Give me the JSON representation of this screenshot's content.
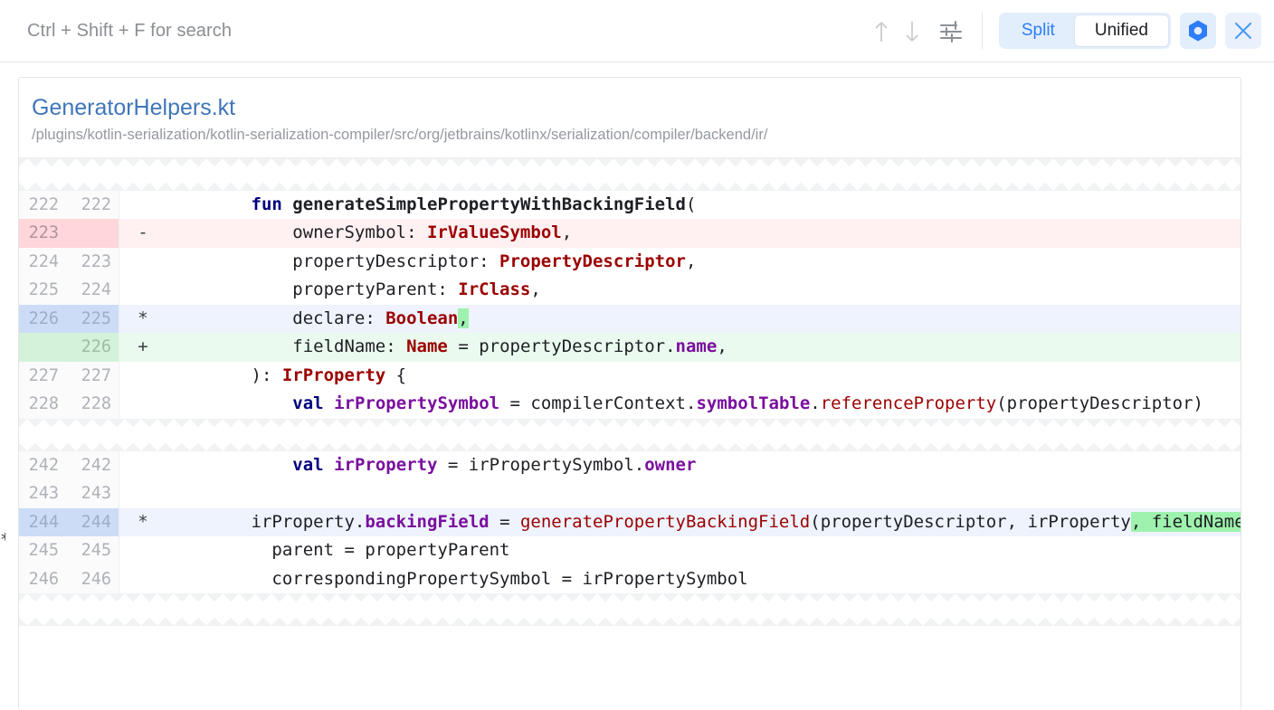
{
  "toolbar": {
    "search_placeholder": "Ctrl + Shift + F for search",
    "prev_diff_icon": "arrow-up-icon",
    "next_diff_icon": "arrow-down-icon",
    "settings_icon": "sliders-settings-icon",
    "view_modes": [
      {
        "label": "Split",
        "active": false
      },
      {
        "label": "Unified",
        "active": true
      }
    ],
    "hexagon_icon": "hexagon-nut-icon",
    "close_icon": "close-x-icon",
    "accent_color": "#2e7dfa",
    "toggle_bg_color": "#e3eefd"
  },
  "file": {
    "name": "GeneratorHelpers.kt",
    "path": "/plugins/kotlin-serialization/kotlin-serialization-compiler/src/org/jetbrains/kotlinx/serialization/compiler/backend/ir/",
    "name_color": "#3f76b8",
    "path_color": "#9599a0"
  },
  "diff": {
    "edge_marker": "*",
    "hunks": [
      {
        "rows": [
          {
            "old": "222",
            "new": "222",
            "marker": "",
            "state": "ctx",
            "segments": [
              {
                "t": "        ",
                "c": ""
              },
              {
                "t": "fun",
                "c": "kw"
              },
              {
                "t": " ",
                "c": ""
              },
              {
                "t": "generateSimplePropertyWithBackingField",
                "c": "fn"
              },
              {
                "t": "(",
                "c": ""
              }
            ]
          },
          {
            "old": "223",
            "new": "",
            "marker": "-",
            "state": "del",
            "segments": [
              {
                "t": "            ownerSymbol: ",
                "c": ""
              },
              {
                "t": "IrValueSymbol",
                "c": "typ"
              },
              {
                "t": ",",
                "c": ""
              }
            ]
          },
          {
            "old": "224",
            "new": "223",
            "marker": "",
            "state": "ctx",
            "segments": [
              {
                "t": "            propertyDescriptor: ",
                "c": ""
              },
              {
                "t": "PropertyDescriptor",
                "c": "typ"
              },
              {
                "t": ",",
                "c": ""
              }
            ]
          },
          {
            "old": "225",
            "new": "224",
            "marker": "",
            "state": "ctx",
            "segments": [
              {
                "t": "            propertyParent: ",
                "c": ""
              },
              {
                "t": "IrClass",
                "c": "typ"
              },
              {
                "t": ",",
                "c": ""
              }
            ]
          },
          {
            "old": "226",
            "new": "225",
            "marker": "*",
            "state": "mod",
            "segments": [
              {
                "t": "            declare: ",
                "c": ""
              },
              {
                "t": "Boolean",
                "c": "typ"
              },
              {
                "t": ",",
                "c": "hl"
              }
            ]
          },
          {
            "old": "",
            "new": "226",
            "marker": "+",
            "state": "add",
            "segments": [
              {
                "t": "            fieldName: ",
                "c": ""
              },
              {
                "t": "Name",
                "c": "typ"
              },
              {
                "t": " = propertyDescriptor.",
                "c": ""
              },
              {
                "t": "name",
                "c": "prop"
              },
              {
                "t": ",",
                "c": ""
              }
            ]
          },
          {
            "old": "227",
            "new": "227",
            "marker": "",
            "state": "ctx",
            "segments": [
              {
                "t": "        ): ",
                "c": ""
              },
              {
                "t": "IrProperty",
                "c": "typ"
              },
              {
                "t": " {",
                "c": ""
              }
            ]
          },
          {
            "old": "228",
            "new": "228",
            "marker": "",
            "state": "ctx",
            "segments": [
              {
                "t": "            ",
                "c": ""
              },
              {
                "t": "val",
                "c": "kw"
              },
              {
                "t": " ",
                "c": ""
              },
              {
                "t": "irPropertySymbol",
                "c": "prop"
              },
              {
                "t": " = compilerContext.",
                "c": ""
              },
              {
                "t": "symbolTable",
                "c": "prop"
              },
              {
                "t": ".",
                "c": ""
              },
              {
                "t": "referenceProperty",
                "c": "call"
              },
              {
                "t": "(propertyDescriptor)",
                "c": ""
              }
            ]
          }
        ]
      },
      {
        "rows": [
          {
            "old": "242",
            "new": "242",
            "marker": "",
            "state": "ctx",
            "segments": [
              {
                "t": "            ",
                "c": ""
              },
              {
                "t": "val",
                "c": "kw"
              },
              {
                "t": " ",
                "c": ""
              },
              {
                "t": "irProperty",
                "c": "prop"
              },
              {
                "t": " = irPropertySymbol.",
                "c": ""
              },
              {
                "t": "owner",
                "c": "prop"
              }
            ]
          },
          {
            "old": "243",
            "new": "243",
            "marker": "",
            "state": "ctx",
            "segments": [
              {
                "t": "",
                "c": ""
              }
            ]
          },
          {
            "old": "244",
            "new": "244",
            "marker": "*",
            "state": "mod",
            "segments": [
              {
                "t": "        irProperty.",
                "c": ""
              },
              {
                "t": "backingField",
                "c": "prop"
              },
              {
                "t": " = ",
                "c": ""
              },
              {
                "t": "generatePropertyBackingField",
                "c": "call"
              },
              {
                "t": "(propertyDescriptor, irProperty",
                "c": ""
              },
              {
                "t": ", fieldName",
                "c": "hl"
              },
              {
                "t": ")",
                "c": ""
              }
            ]
          },
          {
            "old": "245",
            "new": "245",
            "marker": "",
            "state": "ctx",
            "segments": [
              {
                "t": "          parent = propertyParent",
                "c": ""
              }
            ]
          },
          {
            "old": "246",
            "new": "246",
            "marker": "",
            "state": "ctx",
            "segments": [
              {
                "t": "          correspondingPropertySymbol = irPropertySymbol",
                "c": ""
              }
            ]
          }
        ]
      }
    ]
  }
}
